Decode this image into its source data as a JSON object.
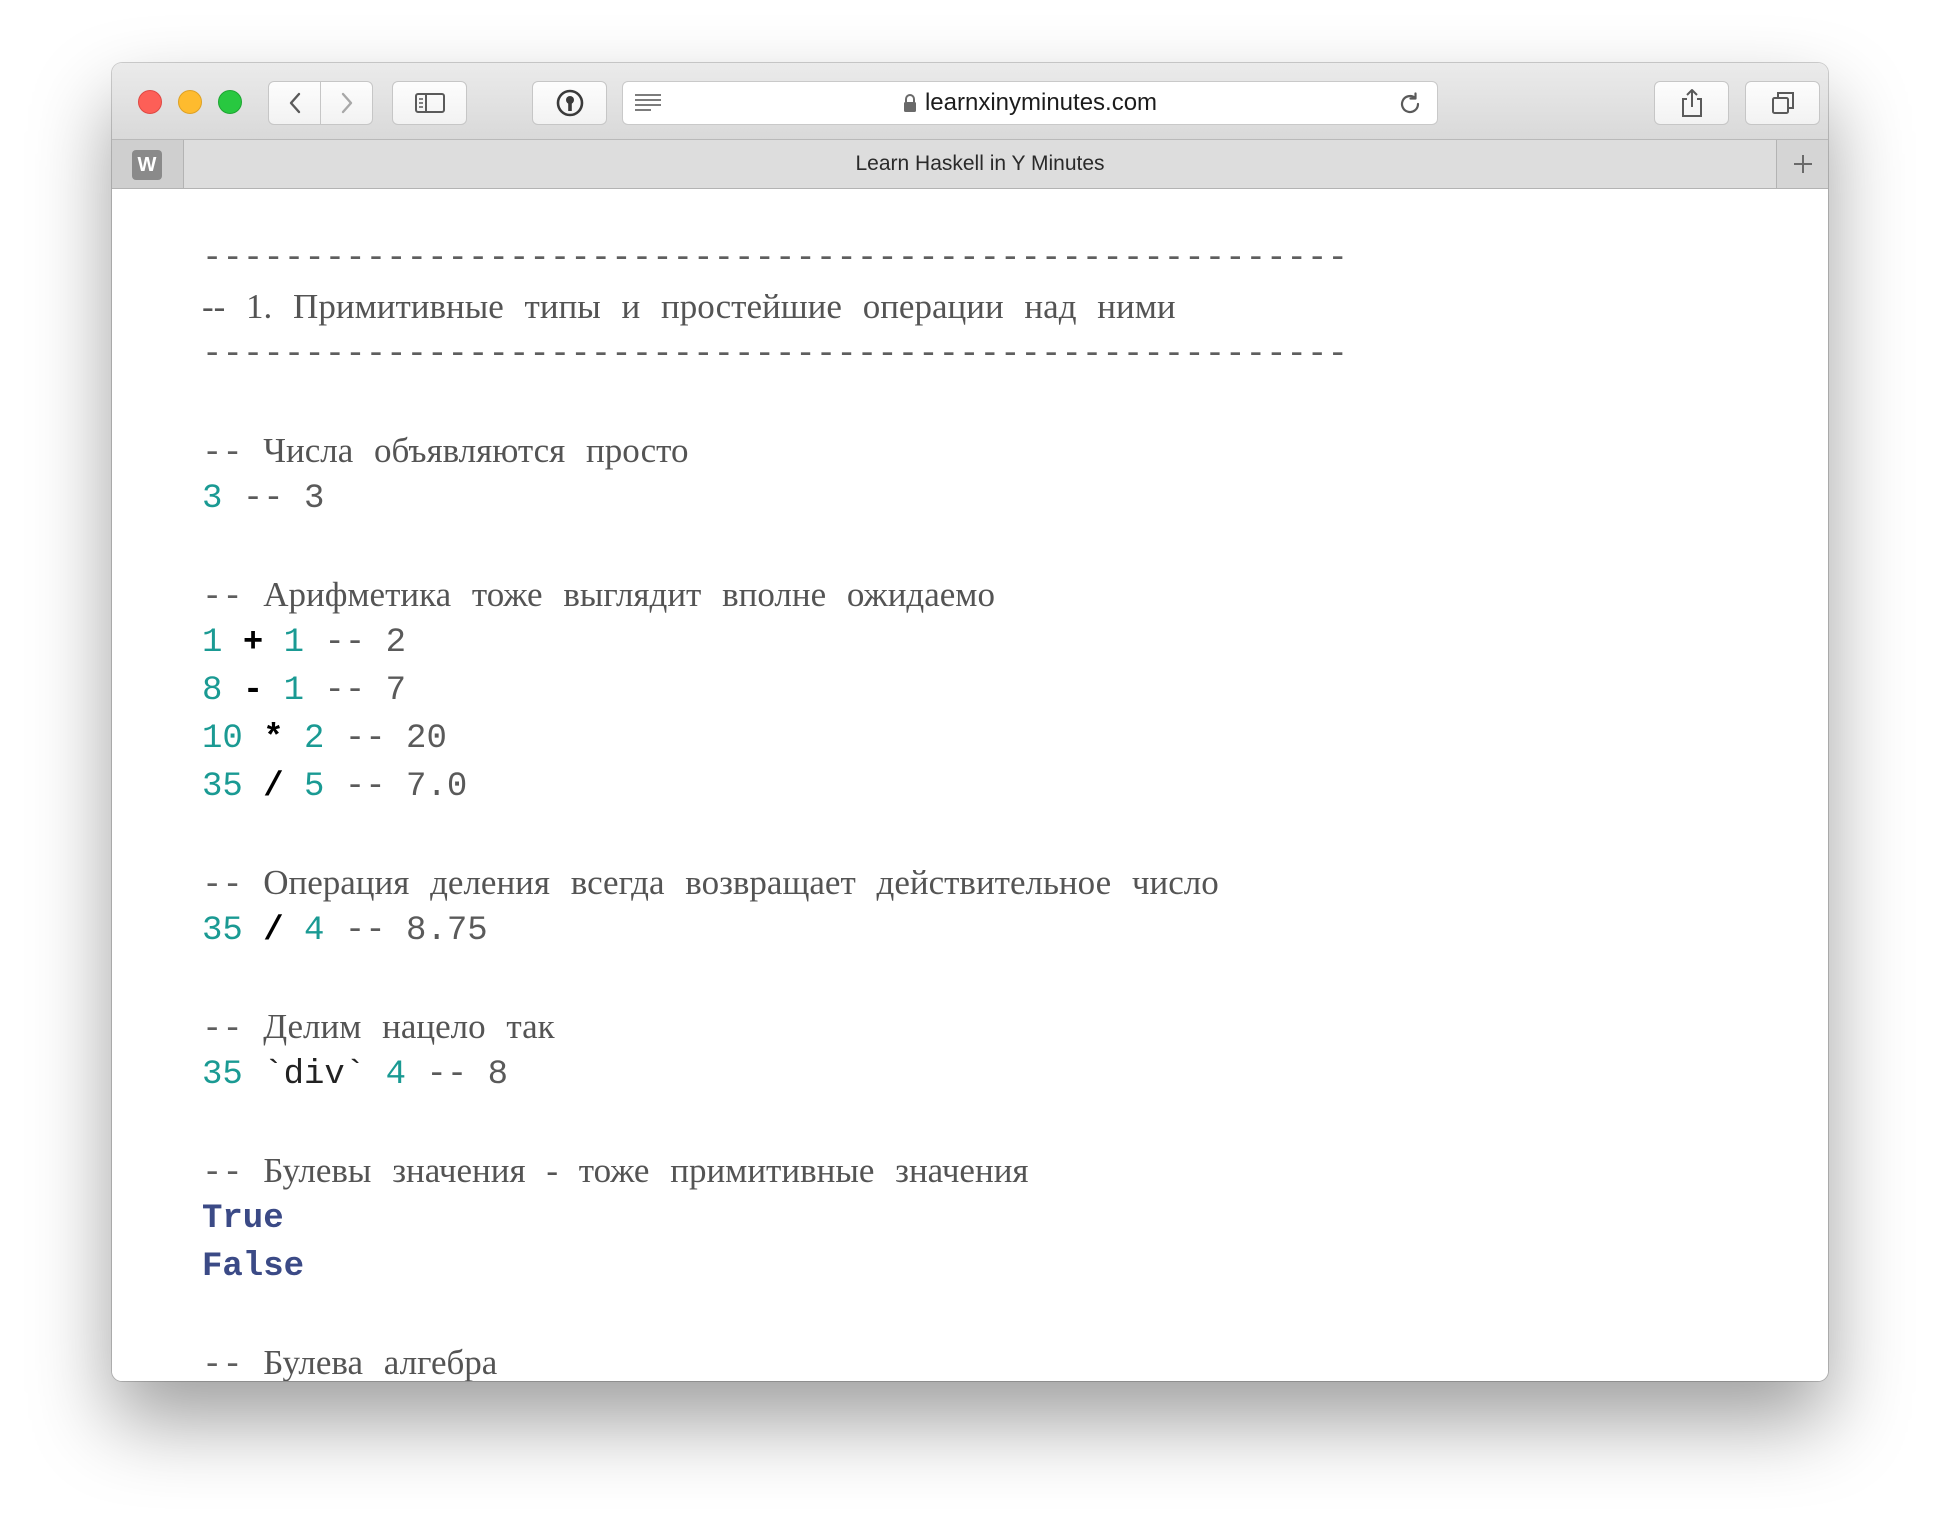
{
  "browser": {
    "url": "learnxinyminutes.com",
    "tab_title": "Learn Haskell in Y Minutes",
    "favicon_letter": "W"
  },
  "code": {
    "rule": "--------------------------------------------------------",
    "section_title": "-- 1. Примитивные типы и простейшие операции над ними",
    "comment_numbers": "Числа объявляются просто",
    "ex_number": {
      "value": "3",
      "result": "-- 3"
    },
    "comment_arith": "Арифметика тоже выглядит вполне ожидаемо",
    "arith": [
      {
        "a": "1",
        "op": "+",
        "b": "1",
        "result": "-- 2"
      },
      {
        "a": "8",
        "op": "-",
        "b": "1",
        "result": "-- 7"
      },
      {
        "a": "10",
        "op": "*",
        "b": "2",
        "result": "-- 20"
      },
      {
        "a": "35",
        "op": "/",
        "b": "5",
        "result": "-- 7.0"
      }
    ],
    "comment_division": "Операция деления всегда возвращает действительное число",
    "division": {
      "a": "35",
      "op": "/",
      "b": "4",
      "result": "-- 8.75"
    },
    "comment_intdiv": "Делим нацело так",
    "intdiv": {
      "a": "35",
      "op": "`div`",
      "b": "4",
      "result": "-- 8"
    },
    "comment_bool": "Булевы значения - тоже примитивные значения",
    "bool_true": "True",
    "bool_false": "False",
    "comment_algebra": "Булева алгебра",
    "comment_prefix": "-- "
  }
}
